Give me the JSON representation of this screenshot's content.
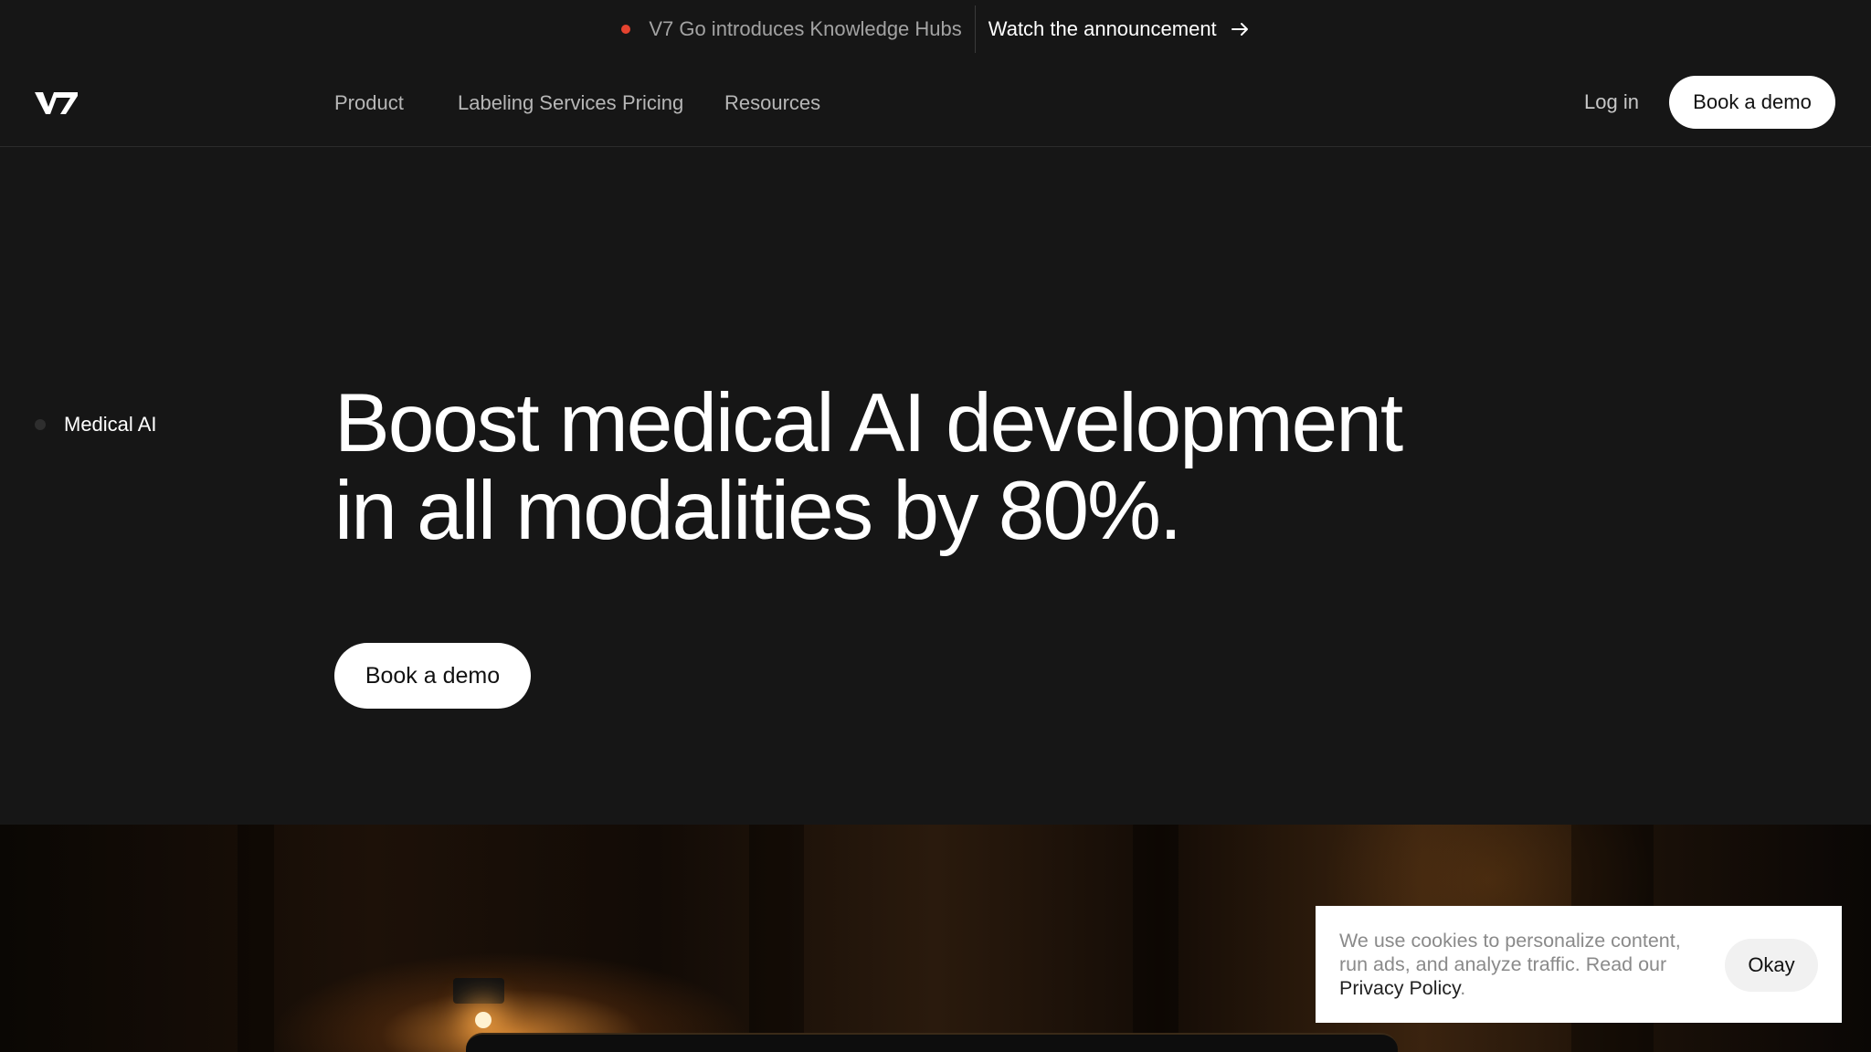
{
  "announcement": {
    "text": "V7 Go introduces Knowledge Hubs",
    "link_label": "Watch the announcement",
    "dot_color": "#e5432f",
    "arrow_icon": "arrow-right-icon"
  },
  "header": {
    "logo_text": "V7",
    "nav": [
      {
        "label": "Product"
      },
      {
        "label": "Labeling Services"
      },
      {
        "label": "Pricing"
      },
      {
        "label": "Resources"
      }
    ],
    "login_label": "Log in",
    "cta_label": "Book a demo"
  },
  "hero": {
    "tag": "Medical AI",
    "headline_line1": "Boost medical AI development",
    "headline_line2": "in all modalities by 80%.",
    "cta_label": "Book a demo"
  },
  "cookie": {
    "text_before": "We use cookies to personalize content, run ads, and analyze traffic. Read our ",
    "link_label": "Privacy Policy",
    "text_after": ".",
    "button_label": "Okay"
  },
  "colors": {
    "background": "#161616",
    "accent_dot": "#e5432f",
    "button_bg": "#ffffff"
  }
}
